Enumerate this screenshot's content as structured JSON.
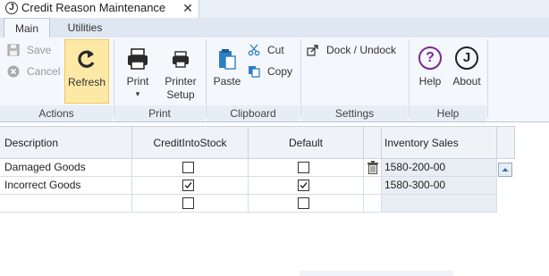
{
  "window": {
    "app_icon_letter": "J",
    "title": "Credit Reason Maintenance",
    "close_glyph": "✕"
  },
  "ribbon_tabs": [
    {
      "label": "Main",
      "active": true
    },
    {
      "label": "Utilities",
      "active": false
    }
  ],
  "ribbon": {
    "actions": {
      "group_label": "Actions",
      "save": {
        "label": "Save",
        "icon": "save-icon",
        "enabled": false
      },
      "cancel": {
        "label": "Cancel",
        "icon": "cancel-icon",
        "enabled": false
      },
      "refresh": {
        "label": "Refresh",
        "icon": "refresh-icon"
      }
    },
    "print": {
      "group_label": "Print",
      "print": {
        "label": "Print",
        "dropdown_glyph": "▾",
        "icon": "printer-icon"
      },
      "printer_setup": {
        "label_line1": "Printer",
        "label_line2": "Setup",
        "icon": "printer-setup-icon"
      }
    },
    "clipboard": {
      "group_label": "Clipboard",
      "paste": {
        "label": "Paste",
        "icon": "paste-icon"
      },
      "cut": {
        "label": "Cut",
        "icon": "cut-icon"
      },
      "copy": {
        "label": "Copy",
        "icon": "copy-icon"
      }
    },
    "settings": {
      "group_label": "Settings",
      "dock": {
        "label": "Dock / Undock",
        "icon": "dock-icon"
      }
    },
    "help": {
      "group_label": "Help",
      "help": {
        "label": "Help",
        "icon": "help-icon",
        "glyph": "?"
      },
      "about": {
        "label": "About",
        "icon": "about-icon",
        "glyph": "J"
      }
    }
  },
  "grid": {
    "columns": {
      "description": "Description",
      "credit_into_stock": "CreditIntoStock",
      "default": "Default",
      "inventory_sales_account": "Inventory Sales Account"
    },
    "rows": [
      {
        "description": "Damaged Goods",
        "credit_into_stock": false,
        "default": false,
        "account": "1580-200-00"
      },
      {
        "description": "Incorrect Goods",
        "credit_into_stock": true,
        "default": true,
        "account": "1580-300-00"
      },
      {
        "description": "",
        "credit_into_stock": false,
        "default": false,
        "account": ""
      }
    ]
  },
  "colors": {
    "ribbon_bg": "#f4f7fb",
    "highlight": "#fde9a6",
    "help_purple": "#7a2a8f",
    "header_bg": "#eff3f8"
  }
}
